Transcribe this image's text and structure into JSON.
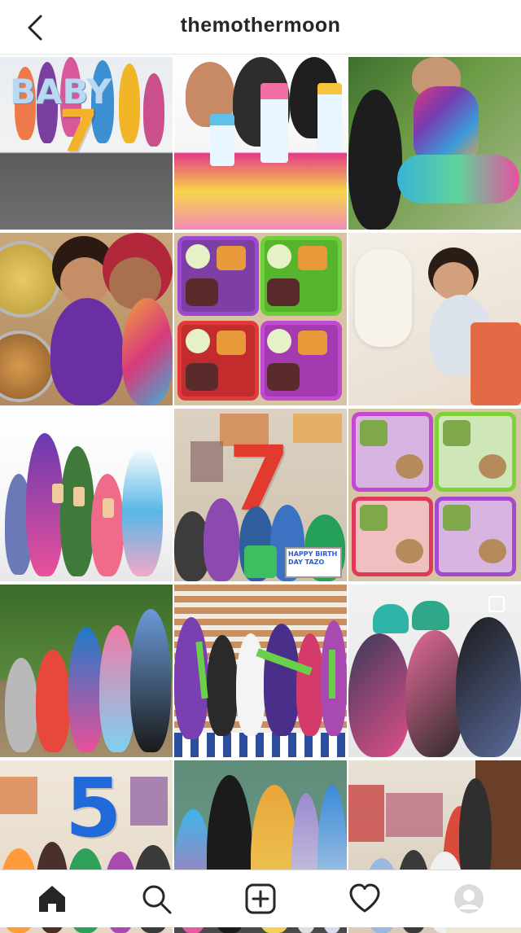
{
  "header": {
    "title": "themothermoon",
    "back_icon": "chevron-left-icon"
  },
  "posts": [
    {
      "name": "post-baby-7",
      "letters": "BABY",
      "number": "7"
    },
    {
      "name": "post-shaved-ice"
    },
    {
      "name": "post-toddler-tie-dye"
    },
    {
      "name": "post-kids-hug"
    },
    {
      "name": "post-lunch-trays"
    },
    {
      "name": "post-sleeping-baby"
    },
    {
      "name": "post-kids-drinks"
    },
    {
      "name": "post-birthday-7",
      "number": "7",
      "sign": "HAPPY BIRTH DAY TAZO"
    },
    {
      "name": "post-healthy-trays"
    },
    {
      "name": "post-kids-garden"
    },
    {
      "name": "post-kids-stairs-celery"
    },
    {
      "name": "post-kids-beanies"
    },
    {
      "name": "post-birthday-5",
      "number": "5",
      "cake_number": "5"
    },
    {
      "name": "post-kids-sitting"
    },
    {
      "name": "post-kids-family-kitchen"
    }
  ],
  "tabbar": {
    "items": [
      {
        "name": "tab-home",
        "icon": "home-icon"
      },
      {
        "name": "tab-search",
        "icon": "search-icon"
      },
      {
        "name": "tab-new-post",
        "icon": "plus-square-icon"
      },
      {
        "name": "tab-activity",
        "icon": "heart-icon"
      },
      {
        "name": "tab-profile",
        "icon": "avatar-icon"
      }
    ]
  }
}
